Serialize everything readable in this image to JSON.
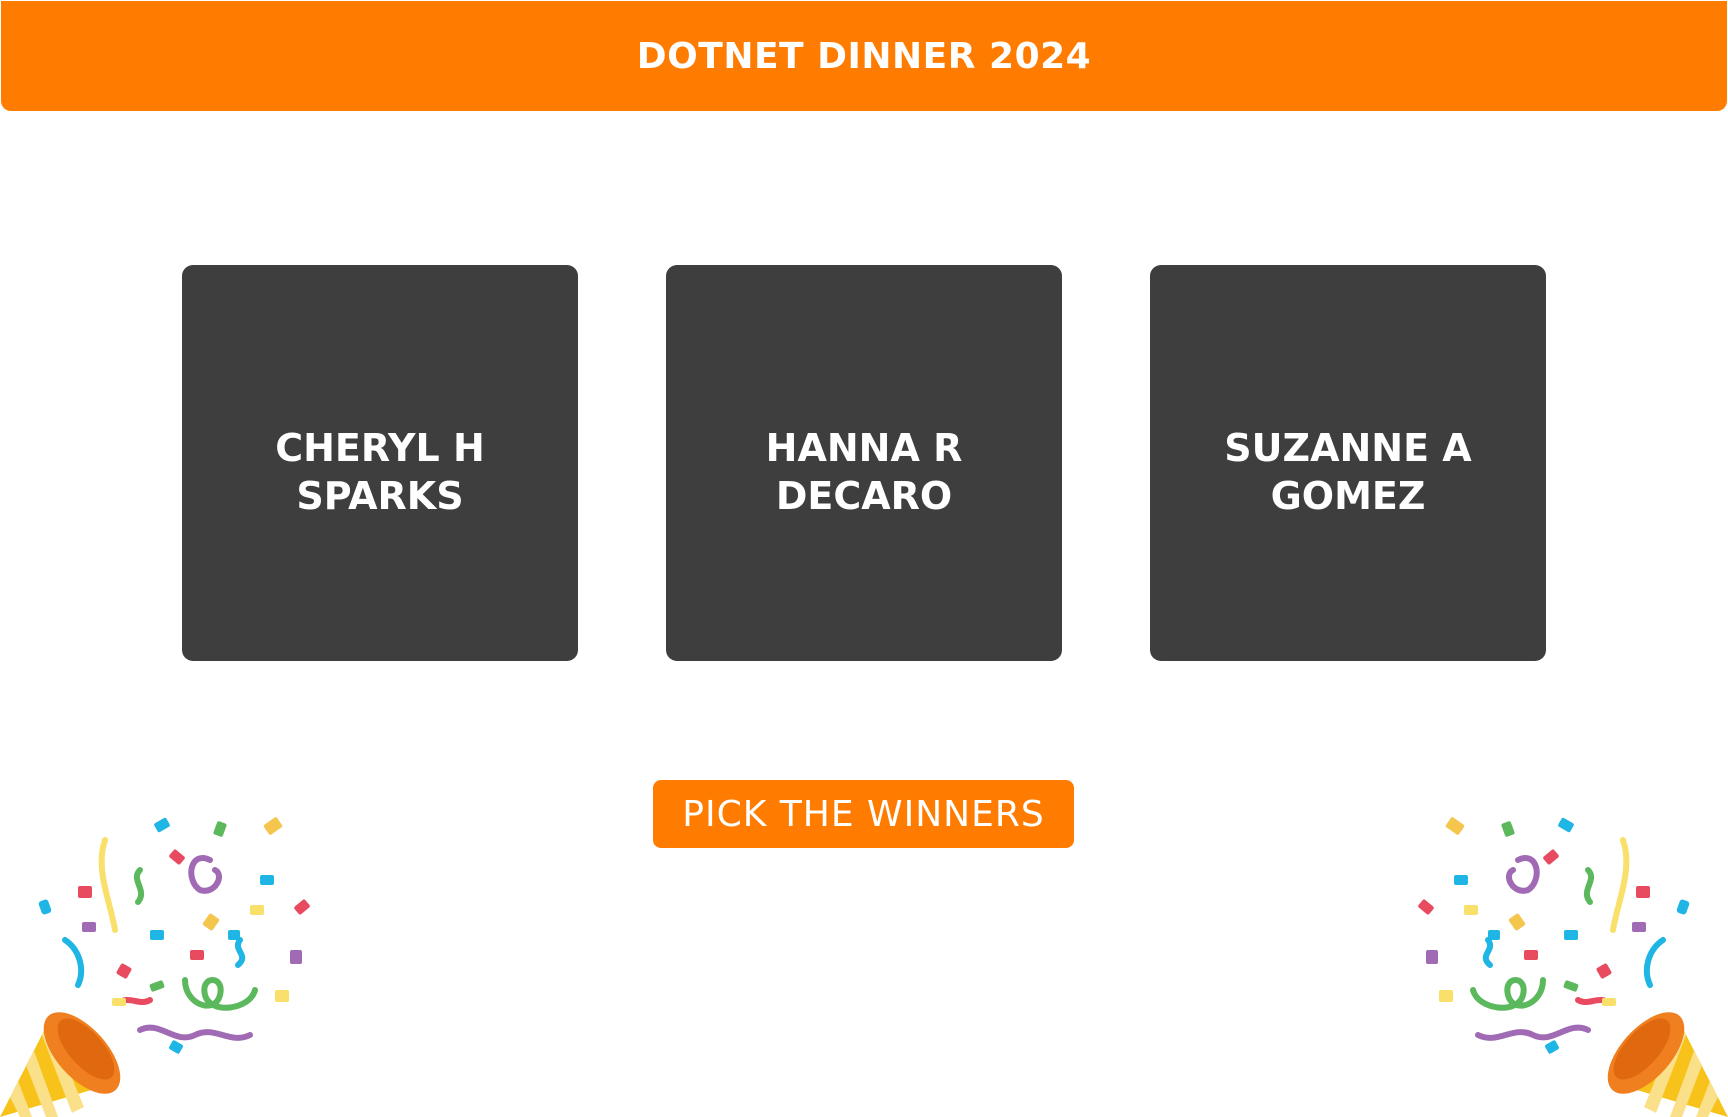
{
  "header": {
    "title": "DOTNET DINNER 2024"
  },
  "winners": [
    {
      "name": "CHERYL H SPARKS"
    },
    {
      "name": "HANNA R DECARO"
    },
    {
      "name": "SUZANNE A GOMEZ"
    }
  ],
  "actions": {
    "pick_label": "PICK THE WINNERS"
  },
  "decorations": {
    "left_icon": "party-popper-icon",
    "right_icon": "party-popper-icon"
  },
  "colors": {
    "accent": "#ff7c01",
    "card": "#3e3e3e",
    "background": "#ffffff"
  }
}
